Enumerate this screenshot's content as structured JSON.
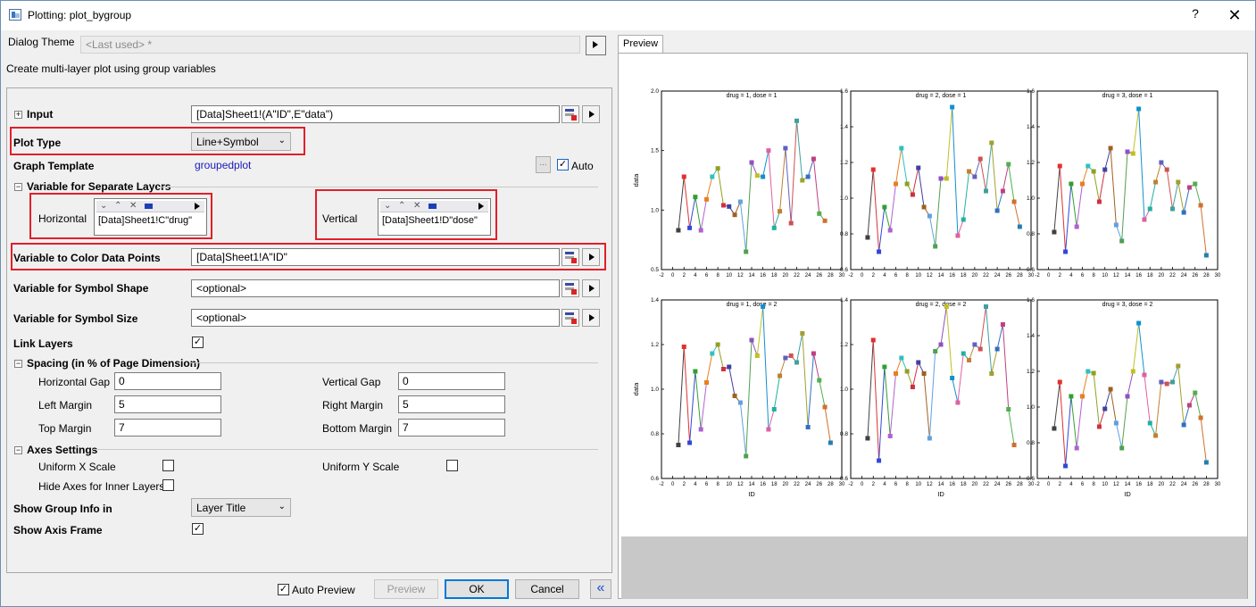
{
  "window": {
    "title": "Plotting: plot_bygroup",
    "help": "?",
    "close": "✕"
  },
  "theme": {
    "label": "Dialog Theme",
    "value": "<Last used> *"
  },
  "description": "Create multi-layer plot using group variables",
  "input": {
    "label": "Input",
    "value": "[Data]Sheet1!(A\"ID\",E\"data\")"
  },
  "plot_type": {
    "label": "Plot Type",
    "value": "Line+Symbol"
  },
  "graph_template": {
    "label": "Graph Template",
    "value": "groupedplot",
    "browse": "...",
    "auto_label": "Auto",
    "auto_checked": true
  },
  "separate_layers": {
    "label": "Variable for Separate Layers",
    "horizontal": {
      "label": "Horizontal",
      "value": "[Data]Sheet1!C\"drug\""
    },
    "vertical": {
      "label": "Vertical",
      "value": "[Data]Sheet1!D\"dose\""
    }
  },
  "color_points": {
    "label": "Variable to Color Data Points",
    "value": "[Data]Sheet1!A\"ID\""
  },
  "symbol_shape": {
    "label": "Variable for Symbol Shape",
    "value": "<optional>"
  },
  "symbol_size": {
    "label": "Variable for Symbol Size",
    "value": "<optional>"
  },
  "link_layers": {
    "label": "Link Layers",
    "checked": true
  },
  "spacing": {
    "label": "Spacing (in % of Page Dimension)",
    "horizontal_gap": {
      "label": "Horizontal Gap",
      "value": "0"
    },
    "vertical_gap": {
      "label": "Vertical Gap",
      "value": "0"
    },
    "left_margin": {
      "label": "Left Margin",
      "value": "5"
    },
    "right_margin": {
      "label": "Right Margin",
      "value": "5"
    },
    "top_margin": {
      "label": "Top Margin",
      "value": "7"
    },
    "bottom_margin": {
      "label": "Bottom Margin",
      "value": "7"
    }
  },
  "axes": {
    "label": "Axes Settings",
    "uniform_x": {
      "label": "Uniform X Scale",
      "checked": false
    },
    "uniform_y": {
      "label": "Uniform Y Scale",
      "checked": false
    },
    "hide_inner": {
      "label": "Hide Axes for Inner Layers",
      "checked": false
    }
  },
  "group_info": {
    "label": "Show Group Info in",
    "value": "Layer Title"
  },
  "axis_frame": {
    "label": "Show Axis Frame",
    "checked": true
  },
  "footer": {
    "auto_preview": "Auto Preview",
    "auto_preview_checked": true,
    "preview": "Preview",
    "ok": "OK",
    "cancel": "Cancel",
    "collapse": "«"
  },
  "preview_tab": "Preview",
  "chart_data": [
    {
      "type": "line",
      "title": "drug = 1, dose = 1",
      "ylabel": "data",
      "ylim": [
        0.5,
        2.0
      ],
      "yticks": [
        "0.5",
        "1.0",
        "1.5",
        "2.0"
      ],
      "xticks": [
        "-2",
        "0",
        "2",
        "4",
        "6",
        "8",
        "10",
        "12",
        "14",
        "16",
        "18",
        "20",
        "22",
        "24",
        "26",
        "28",
        "30"
      ],
      "xlim": [
        -2,
        30
      ],
      "x": [
        1,
        2,
        3,
        4,
        5,
        6,
        7,
        8,
        9,
        10,
        11,
        12,
        13,
        14,
        15,
        16,
        17,
        18,
        19,
        20,
        21,
        22,
        23,
        24,
        25,
        26,
        27,
        28
      ],
      "y": [
        0.83,
        1.28,
        0.85,
        1.11,
        0.83,
        1.09,
        1.28,
        1.35,
        1.04,
        1.03,
        0.96,
        1.07,
        0.65,
        1.4,
        1.29,
        1.28,
        1.5,
        0.85,
        0.99,
        1.52,
        0.89,
        1.75,
        1.25,
        1.28,
        1.43,
        0.97,
        0.91
      ]
    },
    {
      "type": "line",
      "title": "drug = 2, dose = 1",
      "ylabel": "",
      "ylim": [
        0.6,
        1.6
      ],
      "yticks": [
        "0.6",
        "0.8",
        "1.0",
        "1.2",
        "1.4",
        "1.6"
      ],
      "xticks": [
        "-2",
        "0",
        "2",
        "4",
        "6",
        "8",
        "10",
        "12",
        "14",
        "16",
        "18",
        "20",
        "22",
        "24",
        "26",
        "28",
        "30"
      ],
      "xlim": [
        -2,
        30
      ],
      "x": [
        1,
        2,
        3,
        4,
        5,
        6,
        7,
        8,
        9,
        10,
        11,
        12,
        13,
        14,
        15,
        16,
        17,
        18,
        19,
        20,
        21,
        22,
        23,
        24,
        25,
        26,
        27,
        28
      ],
      "y": [
        0.78,
        1.16,
        0.7,
        0.95,
        0.82,
        1.08,
        1.28,
        1.08,
        1.02,
        1.17,
        0.95,
        0.9,
        0.73,
        1.11,
        1.11,
        1.51,
        0.79,
        0.88,
        1.15,
        1.12,
        1.22,
        1.04,
        1.31,
        0.93,
        1.04,
        1.19,
        0.98,
        0.84
      ]
    },
    {
      "type": "line",
      "title": "drug = 3, dose = 1",
      "ylabel": "",
      "ylim": [
        0.6,
        1.6
      ],
      "yticks": [
        "0.6",
        "0.8",
        "1.0",
        "1.2",
        "1.4",
        "1.6"
      ],
      "xticks": [
        "-2",
        "0",
        "2",
        "4",
        "6",
        "8",
        "10",
        "12",
        "14",
        "16",
        "18",
        "20",
        "22",
        "24",
        "26",
        "28",
        "30"
      ],
      "xlim": [
        -2,
        30
      ],
      "x": [
        1,
        2,
        3,
        4,
        5,
        6,
        7,
        8,
        9,
        10,
        11,
        12,
        13,
        14,
        15,
        16,
        17,
        18,
        19,
        20,
        21,
        22,
        23,
        24,
        25,
        26,
        27,
        28
      ],
      "y": [
        0.81,
        1.18,
        0.7,
        1.08,
        0.84,
        1.08,
        1.18,
        1.15,
        0.98,
        1.16,
        1.28,
        0.85,
        0.76,
        1.26,
        1.25,
        1.5,
        0.88,
        0.94,
        1.09,
        1.2,
        1.16,
        0.94,
        1.09,
        0.92,
        1.06,
        1.08,
        0.96,
        0.68
      ]
    },
    {
      "type": "line",
      "title": "drug = 1, dose = 2",
      "ylabel": "data",
      "xlabel": "ID",
      "ylim": [
        0.6,
        1.4
      ],
      "yticks": [
        "0.6",
        "0.8",
        "1.0",
        "1.2",
        "1.4"
      ],
      "xticks": [
        "-2",
        "0",
        "2",
        "4",
        "6",
        "8",
        "10",
        "12",
        "14",
        "16",
        "18",
        "20",
        "22",
        "24",
        "26",
        "28",
        "30"
      ],
      "xlim": [
        -2,
        30
      ],
      "x": [
        1,
        2,
        3,
        4,
        5,
        6,
        7,
        8,
        9,
        10,
        11,
        12,
        13,
        14,
        15,
        16,
        17,
        18,
        19,
        20,
        21,
        22,
        23,
        24,
        25,
        26,
        27,
        28
      ],
      "y": [
        0.75,
        1.19,
        0.76,
        1.08,
        0.82,
        1.03,
        1.16,
        1.2,
        1.09,
        1.1,
        0.97,
        0.94,
        0.7,
        1.22,
        1.15,
        1.37,
        0.82,
        0.91,
        1.06,
        1.14,
        1.15,
        1.12,
        1.25,
        0.83,
        1.16,
        1.04,
        0.92,
        0.76
      ]
    },
    {
      "type": "line",
      "title": "drug = 2, dose = 2",
      "ylabel": "",
      "xlabel": "ID",
      "ylim": [
        0.6,
        1.4
      ],
      "yticks": [
        "0.6",
        "0.8",
        "1.0",
        "1.2",
        "1.4"
      ],
      "xticks": [
        "-2",
        "0",
        "2",
        "4",
        "6",
        "8",
        "10",
        "12",
        "14",
        "16",
        "18",
        "20",
        "22",
        "24",
        "26",
        "28",
        "30"
      ],
      "xlim": [
        -2,
        30
      ],
      "x": [
        1,
        2,
        3,
        4,
        5,
        6,
        7,
        8,
        9,
        10,
        11,
        12,
        13,
        14,
        15,
        16,
        17,
        18,
        19,
        20,
        21,
        22,
        23,
        24,
        25,
        26,
        27,
        28
      ],
      "y": [
        0.78,
        1.22,
        0.68,
        1.1,
        0.79,
        1.07,
        1.14,
        1.08,
        1.01,
        1.12,
        1.07,
        0.78,
        1.17,
        1.2,
        1.37,
        1.05,
        0.94,
        1.16,
        1.13,
        1.2,
        1.18,
        1.37,
        1.07,
        1.18,
        1.29,
        0.91,
        0.75
      ]
    },
    {
      "type": "line",
      "title": "drug = 3, dose = 2",
      "ylabel": "",
      "xlabel": "ID",
      "ylim": [
        0.6,
        1.6
      ],
      "yticks": [
        "0.6",
        "0.8",
        "1.0",
        "1.2",
        "1.4",
        "1.6"
      ],
      "xticks": [
        "-2",
        "0",
        "2",
        "4",
        "6",
        "8",
        "10",
        "12",
        "14",
        "16",
        "18",
        "20",
        "22",
        "24",
        "26",
        "28",
        "30"
      ],
      "xlim": [
        -2,
        30
      ],
      "x": [
        1,
        2,
        3,
        4,
        5,
        6,
        7,
        8,
        9,
        10,
        11,
        12,
        13,
        14,
        15,
        16,
        17,
        18,
        19,
        20,
        21,
        22,
        23,
        24,
        25,
        26,
        27,
        28
      ],
      "y": [
        0.88,
        1.14,
        0.67,
        1.06,
        0.77,
        1.06,
        1.2,
        1.19,
        0.89,
        0.99,
        1.1,
        0.91,
        0.77,
        1.06,
        1.2,
        1.47,
        1.18,
        0.91,
        0.84,
        1.14,
        1.13,
        1.14,
        1.23,
        0.9,
        1.01,
        1.08,
        0.94,
        0.69
      ]
    }
  ],
  "series_colors": [
    "#404040",
    "#e03030",
    "#3048d8",
    "#30a030",
    "#b060d0",
    "#e88020",
    "#30c0c0",
    "#90a020",
    "#d03040",
    "#4040a0",
    "#a06020",
    "#60a0e0",
    "#50a050",
    "#9050c0",
    "#c0c020",
    "#1090d0",
    "#e060a0",
    "#20b0a0",
    "#c08030",
    "#6060c0",
    "#d05050",
    "#40a0a0",
    "#a0a030",
    "#3070c0",
    "#c04080",
    "#50b050",
    "#d07030",
    "#2080b0"
  ]
}
